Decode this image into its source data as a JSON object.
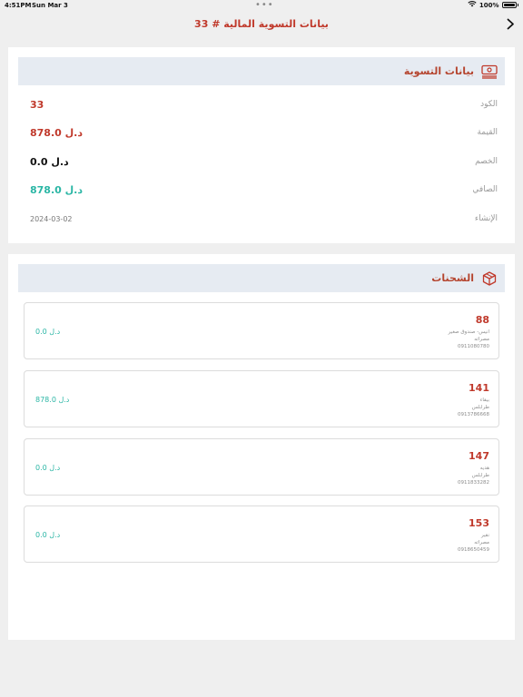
{
  "status_bar": {
    "time": "4:51PM",
    "date": "Sun Mar 3",
    "dots": "•••",
    "battery": "100%"
  },
  "nav": {
    "title": "بيانات التسوية المالية # 33"
  },
  "settlement": {
    "title": "بيانات التسوية",
    "fields": [
      {
        "label": "الكود",
        "value": "33"
      },
      {
        "label": "القيمة",
        "value": "878.0 د.ل"
      },
      {
        "label": "الخصم",
        "value": "0.0 د.ل"
      },
      {
        "label": "الصافي",
        "value": "878.0 د.ل"
      },
      {
        "label": "الإنشاء",
        "value": "2024-03-02"
      }
    ]
  },
  "shipments": {
    "title": "الشحنات",
    "items": [
      {
        "id": "88",
        "name": "انيس- صندوق صغير",
        "city": "مصراته",
        "phone": "0911080780",
        "amount": "0.0 د.ل"
      },
      {
        "id": "141",
        "name": "بيقاء",
        "city": "طرابلس",
        "phone": "0913786668",
        "amount": "878.0 د.ل"
      },
      {
        "id": "147",
        "name": "هديه",
        "city": "طرابلس",
        "phone": "0911833282",
        "amount": "0.0 د.ل"
      },
      {
        "id": "153",
        "name": "نقير",
        "city": "مصراته",
        "phone": "0918650459",
        "amount": "0.0 د.ل"
      }
    ]
  },
  "colors": {
    "accent": "#c0392b",
    "net": "#2bb6a5",
    "header_bg": "#e6ebf2",
    "page_bg": "#efefef"
  },
  "icons": {
    "settlement": "money-stack-icon",
    "shipments": "package-icon",
    "back": "chevron-right-icon",
    "wifi": "wifi-icon",
    "battery": "battery-icon"
  }
}
